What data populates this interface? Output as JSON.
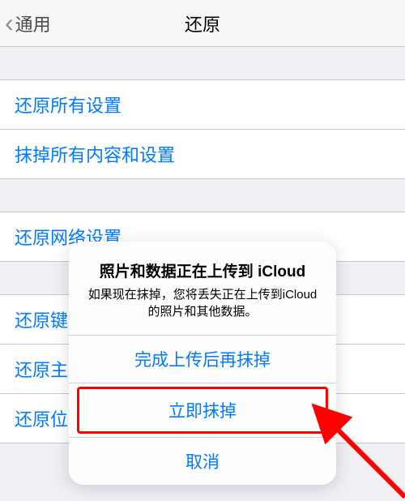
{
  "nav": {
    "back_label": "通用",
    "title": "还原"
  },
  "group1": {
    "items": [
      {
        "label": "还原所有设置"
      },
      {
        "label": "抹掉所有内容和设置"
      }
    ]
  },
  "group2": {
    "items": [
      {
        "label": "还原网络设置"
      }
    ]
  },
  "group3": {
    "items": [
      {
        "label": "还原键盘词典"
      },
      {
        "label": "还原主屏幕布局"
      },
      {
        "label": "还原位置与隐私"
      }
    ]
  },
  "alert": {
    "title": "照片和数据正在上传到 iCloud",
    "message": "如果现在抹掉，您将丢失正在上传到iCloud的照片和其他数据。",
    "button_finish": "完成上传后再抹掉",
    "button_erase": "立即抹掉",
    "button_cancel": "取消"
  }
}
